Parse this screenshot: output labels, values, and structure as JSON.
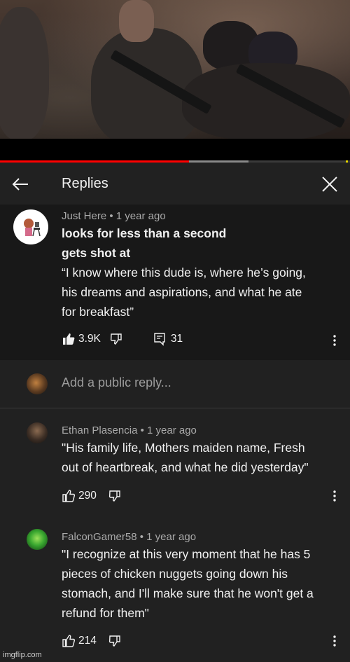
{
  "header": {
    "title": "Replies"
  },
  "main_comment": {
    "author": "Just Here",
    "time": "1 year ago",
    "text_line1": "looks for less than a second",
    "text_line2": "gets shot at",
    "text_line3": "“I know where this dude is, where he’s going,",
    "text_line4": "his dreams and aspirations, and what he ate",
    "text_line5": "for breakfast”",
    "likes": "3.9K",
    "replies": "31"
  },
  "reply_input": {
    "placeholder": "Add a public reply..."
  },
  "replies": [
    {
      "author": "Ethan Plasencia",
      "time": "1 year ago",
      "lines": [
        "\"His family life, Mothers maiden name,  Fresh",
        "out of heartbreak, and what he did yesterday\""
      ],
      "likes": "290"
    },
    {
      "author": "FalconGamer58",
      "time": "1 year ago",
      "lines": [
        "\"I recognize at this very moment that he has 5",
        "pieces of chicken nuggets going down his",
        "stomach, and I'll make sure that he won't get a",
        "refund for them\""
      ],
      "likes": "214"
    }
  ],
  "watermark": "imgflip.com",
  "colors": {
    "progress_played": "#ff0000",
    "background": "#212121",
    "comment_bg": "#181818",
    "meta_text": "#aaaaaa"
  },
  "video_progress": {
    "played_fraction": 0.54,
    "buffered_fraction": 0.71
  }
}
